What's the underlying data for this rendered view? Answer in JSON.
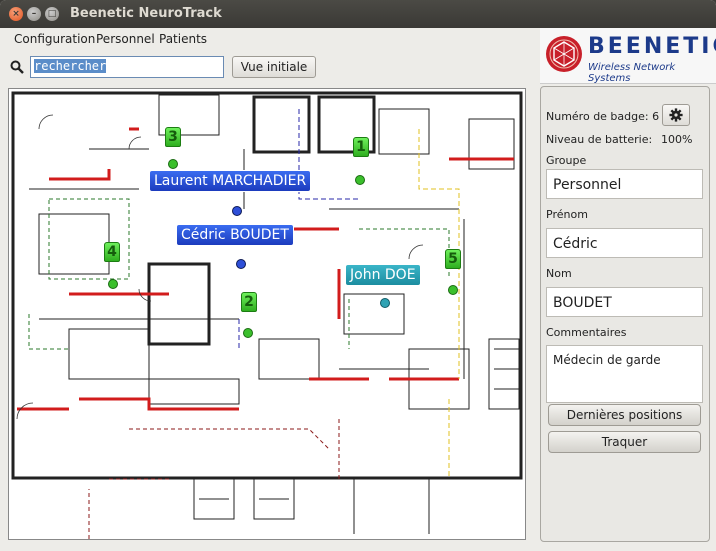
{
  "window": {
    "title": "Beenetic NeuroTrack"
  },
  "menu": {
    "items": [
      "Configuration",
      "Personnel",
      "Patients"
    ]
  },
  "search": {
    "value": "rechercher",
    "button_label": "Vue initiale"
  },
  "logo": {
    "name": "BEENETIC",
    "subtitle": "Wireless Network Systems"
  },
  "map": {
    "people": [
      {
        "name": "Laurent MARCHADIER",
        "color": "blue"
      },
      {
        "name": "Cédric BOUDET",
        "color": "blue"
      },
      {
        "name": "John DOE",
        "color": "teal"
      }
    ],
    "badges": [
      "3",
      "1",
      "4",
      "2",
      "5"
    ]
  },
  "panel": {
    "badge_label": "Numéro de badge: 6",
    "battery_label": "Niveau de batterie:",
    "battery_value": "100%",
    "group_label": "Groupe",
    "group_value": "Personnel",
    "firstname_label": "Prénom",
    "firstname_value": "Cédric",
    "lastname_label": "Nom",
    "lastname_value": "BOUDET",
    "comments_label": "Commentaires",
    "comments_value": "Médecin de garde",
    "last_positions_button": "Dernières positions",
    "track_button": "Traquer"
  },
  "colors": {
    "callout_blue": "#2e4fd8",
    "callout_teal": "#2fa2b3",
    "badge_green": "#3bbf2c",
    "logo_blue": "#1c3a8a"
  }
}
